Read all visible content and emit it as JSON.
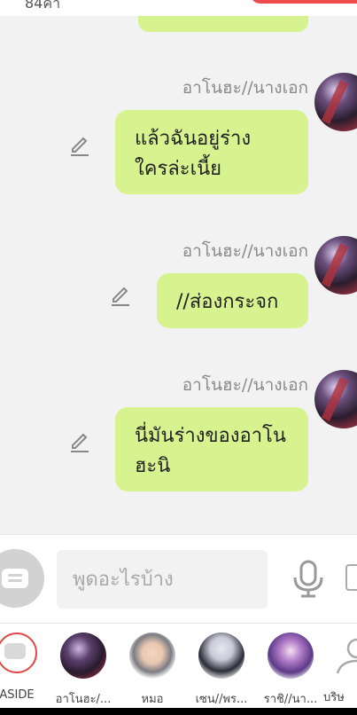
{
  "top": {
    "count_text": "84คำ"
  },
  "messages": [
    {
      "sender": "อาโนฮะ//นางเอก",
      "text_lines": [
        "แล้วฉันอยู่ร่าง",
        "ใครล่ะเนี้ย"
      ]
    },
    {
      "sender": "อาโนฮะ//นางเอก",
      "text_lines": [
        "//ส่องกระจก"
      ]
    },
    {
      "sender": "อาโนฮะ//นางเอก",
      "text_lines": [
        "นี่มันร่างของอาโน",
        "ฮะนิ"
      ]
    }
  ],
  "input": {
    "placeholder": "พูดอะไรบ้าง"
  },
  "characters": [
    {
      "name": "ASIDE"
    },
    {
      "name": "อาโนฮะ/..."
    },
    {
      "name": "หมอ"
    },
    {
      "name": "เซน//พร..."
    },
    {
      "name": "ราชิ//นา..."
    },
    {
      "name": "บริษ"
    }
  ],
  "colors": {
    "bubble": "#d7f38f",
    "accent_red": "#f04b4b",
    "background": "#f2f2f2"
  }
}
